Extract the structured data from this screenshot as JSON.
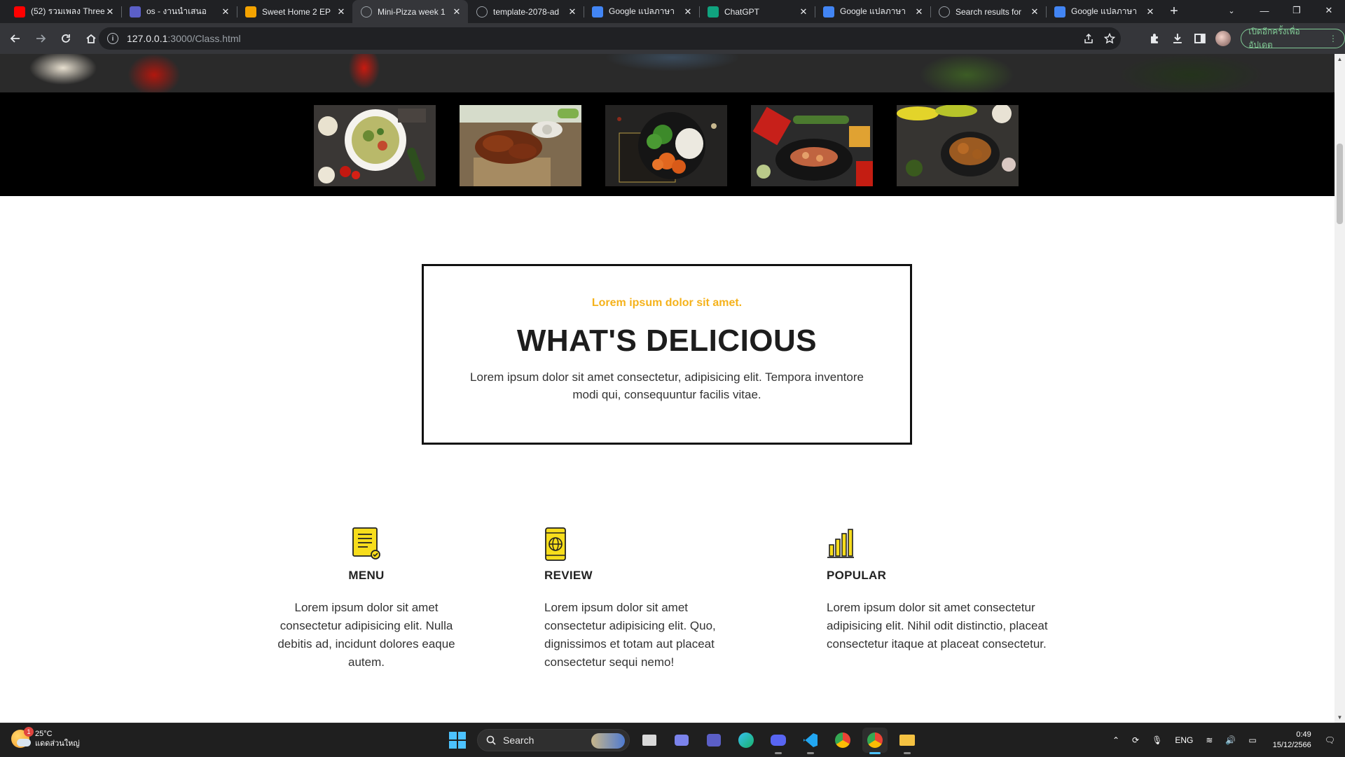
{
  "browser": {
    "tabs": [
      {
        "title": "(52) รวมเพลง Three",
        "icon": "youtube-icon",
        "color": "#ff0000"
      },
      {
        "title": "os - งานนำเสนอ",
        "icon": "teams-shield-icon",
        "color": "#5b5fc7"
      },
      {
        "title": "Sweet Home 2 EP",
        "icon": "webtoon-icon",
        "color": "#f4a300"
      },
      {
        "title": "Mini-Pizza week 1",
        "icon": "globe-icon",
        "color": "#9aa0a6",
        "active": true
      },
      {
        "title": "template-2078-ad",
        "icon": "globe-icon",
        "color": "#9aa0a6"
      },
      {
        "title": "Google แปลภาษา",
        "icon": "google-translate-icon",
        "color": "#4285f4"
      },
      {
        "title": "ChatGPT",
        "icon": "chatgpt-icon",
        "color": "#10a37f"
      },
      {
        "title": "Google แปลภาษา",
        "icon": "google-translate-icon",
        "color": "#4285f4"
      },
      {
        "title": "Search results for",
        "icon": "globe-icon",
        "color": "#9aa0a6"
      },
      {
        "title": "Google แปลภาษา",
        "icon": "google-translate-icon",
        "color": "#4285f4"
      }
    ],
    "url_host": "127.0.0.1",
    "url_path": ":3000/Class.html",
    "update_label": "เปิดอีกครั้งเพื่ออัปเดต"
  },
  "page": {
    "kicker": "Lorem ipsum dolor sit amet.",
    "headline": "WHAT'S DELICIOUS",
    "lead": "Lorem ipsum dolor sit amet consectetur, adipisicing elit. Tempora inventore modi qui, consequuntur facilis vitae.",
    "features": [
      {
        "icon": "menu-document-icon",
        "title": "MENU",
        "text": "Lorem ipsum dolor sit amet consectetur adipisicing elit. Nulla debitis ad, incidunt dolores eaque autem."
      },
      {
        "icon": "mobile-globe-icon",
        "title": "REVIEW",
        "text": "Lorem ipsum dolor sit amet consectetur adipisicing elit. Quo, dignissimos et totam aut placeat consectetur sequi nemo!"
      },
      {
        "icon": "bar-chart-icon",
        "title": "POPULAR",
        "text": "Lorem ipsum dolor sit amet consectetur adipisicing elit. Nihil odit distinctio, placeat consectetur itaque at placeat consectetur."
      }
    ],
    "accent_color": "#f5b21b",
    "icon_color": "#f7dd1c"
  },
  "taskbar": {
    "weather_temp": "25°C",
    "weather_desc": "แดดส่วนใหญ่",
    "weather_badge": "1",
    "search_label": "Search",
    "language": "ENG",
    "time": "0:49",
    "date": "15/12/2566"
  }
}
